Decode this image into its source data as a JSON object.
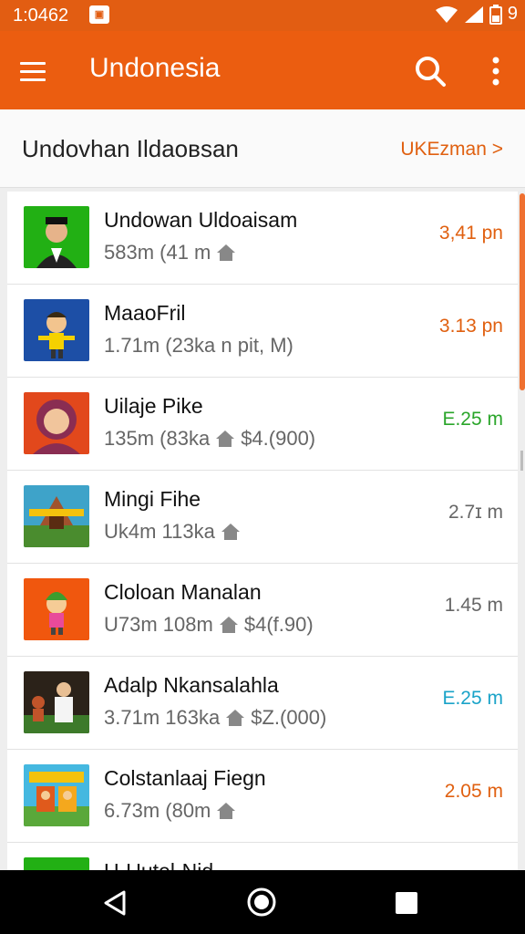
{
  "status_bar": {
    "time": "1:0462",
    "notif_icon": "notification-badge-icon",
    "battery_pct": "9"
  },
  "app_bar": {
    "title": "Undonesia",
    "menu_icon": "hamburger-menu-icon",
    "search_icon": "search-icon",
    "more_icon": "more-vert-icon"
  },
  "section": {
    "title": "Undovhan Ildaoвsan",
    "link": "UKEzman >"
  },
  "colors": {
    "accent": "#eb5d10",
    "orange_text": "#e06010",
    "green_text": "#2aa52a",
    "teal_text": "#1aa3c8",
    "gray_text": "#666666"
  },
  "rows": [
    {
      "title": "Undowan Uldoaisam",
      "meta": "583m (41 m",
      "right": "3,41 pn",
      "right_color": "#e06010",
      "thumb": "person-portrait-green",
      "meta_icon": "home-icon",
      "price": ""
    },
    {
      "title": "MaaoFril",
      "meta": "1.71m (23ka n pit, M)",
      "right": "3.13 pn",
      "right_color": "#e06010",
      "thumb": "cartoon-boy-blue",
      "meta_icon": "",
      "price": ""
    },
    {
      "title": "Uilaje Pike",
      "meta": "135m (83ka",
      "right": "E.25 m",
      "right_color": "#2aa52a",
      "thumb": "hijab-girl-portrait",
      "meta_icon": "home-icon",
      "price": "$4.(900)"
    },
    {
      "title": "Mingi Fihe",
      "meta": "Uk4m 113ka",
      "right": "2.7ɪ m",
      "right_color": "#666666",
      "thumb": "temple-poster",
      "meta_icon": "home-icon",
      "price": ""
    },
    {
      "title": "Cloloan Manalan",
      "meta": "U73m 108m",
      "right": "1.45 m",
      "right_color": "#666666",
      "thumb": "cartoon-character-orange",
      "meta_icon": "home-icon",
      "price": "$4(f.90)"
    },
    {
      "title": "Adalp Nkansalahla",
      "meta": "3.71m 163ka",
      "right": "E.25 m",
      "right_color": "#1aa3c8",
      "thumb": "man-in-white-scene",
      "meta_icon": "home-icon",
      "price": "$Z.(000)"
    },
    {
      "title": "Colstanlaaj Fiegn",
      "meta": "6.73m (80m",
      "right": "2.05 m",
      "right_color": "#e06010",
      "thumb": "cartoon-market-scene",
      "meta_icon": "home-icon",
      "price": ""
    },
    {
      "title": "U-Uutel-Nid",
      "meta": "",
      "right": "",
      "right_color": "#666666",
      "thumb": "green-thumb-partial",
      "meta_icon": "",
      "price": ""
    }
  ],
  "nav_bar": {
    "back_icon": "back-triangle-icon",
    "home_icon": "home-circle-icon",
    "recents_icon": "recents-square-icon"
  }
}
